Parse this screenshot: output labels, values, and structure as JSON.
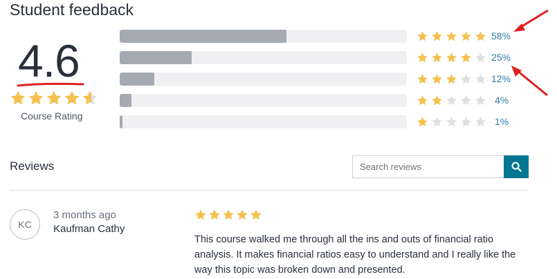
{
  "header": {
    "title": "Student feedback"
  },
  "summary": {
    "rating": "4.6",
    "stars": [
      1,
      1,
      1,
      1,
      0.6
    ],
    "label": "Course Rating"
  },
  "distribution": [
    {
      "stars": 5,
      "percent": 58,
      "label": "58%"
    },
    {
      "stars": 4,
      "percent": 25,
      "label": "25%"
    },
    {
      "stars": 3,
      "percent": 12,
      "label": "12%"
    },
    {
      "stars": 2,
      "percent": 4,
      "label": "4%"
    },
    {
      "stars": 1,
      "percent": 1,
      "label": "1%"
    }
  ],
  "reviews": {
    "heading": "Reviews",
    "search_placeholder": "Search reviews",
    "search_icon": "search-icon",
    "items": [
      {
        "initials": "KC",
        "time": "3 months ago",
        "name": "Kaufman Cathy",
        "stars": 5,
        "text": "This course walked me through all the ins and outs of financial ratio analysis. It makes financial ratios easy to understand and I really like the way this topic was broken down and presented."
      }
    ]
  },
  "colors": {
    "star": "#f4c150",
    "star_empty": "#dedfe0",
    "bar_fill": "#a5a9b2",
    "bar_track": "#f0f0f3",
    "percent_link": "#2f7da9",
    "search_button": "#007791",
    "annotation": "#e02020"
  }
}
